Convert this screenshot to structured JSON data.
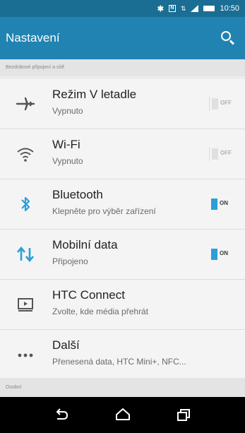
{
  "status_bar": {
    "time": "10:50",
    "icons": [
      "bluetooth-icon",
      "nfc-icon",
      "data-icon",
      "signal-icon",
      "battery-icon"
    ]
  },
  "app_bar": {
    "title": "Nastavení",
    "search_icon": "search-icon"
  },
  "sections": [
    {
      "header": "Bezdrátové připojení a sítě"
    },
    {
      "header": "Osobní"
    }
  ],
  "items": [
    {
      "icon": "airplane-icon",
      "title": "Režim V letadle",
      "subtitle": "Vypnuto",
      "toggle": {
        "state": "off",
        "label": "OFF"
      }
    },
    {
      "icon": "wifi-icon",
      "title": "Wi-Fi",
      "subtitle": "Vypnuto",
      "toggle": {
        "state": "off",
        "label": "OFF"
      }
    },
    {
      "icon": "bluetooth-icon",
      "title": "Bluetooth",
      "subtitle": "Klepněte pro výběr zařízení",
      "toggle": {
        "state": "on",
        "label": "ON"
      }
    },
    {
      "icon": "mobile-data-icon",
      "title": "Mobilní data",
      "subtitle": "Připojeno",
      "toggle": {
        "state": "on",
        "label": "ON"
      }
    },
    {
      "icon": "htc-connect-icon",
      "title": "HTC Connect",
      "subtitle": "Zvolte, kde média přehrát"
    },
    {
      "icon": "more-icon",
      "title": "Další",
      "subtitle": "Přenesená data, HTC Mini+, NFC..."
    }
  ],
  "navigation_bar": {
    "buttons": [
      "back-icon",
      "home-icon",
      "recent-apps-icon"
    ]
  },
  "colors": {
    "status_bar": "#1a6e93",
    "app_bar": "#2083b1",
    "accent": "#2b9fd8",
    "background": "#f4f4f4"
  }
}
